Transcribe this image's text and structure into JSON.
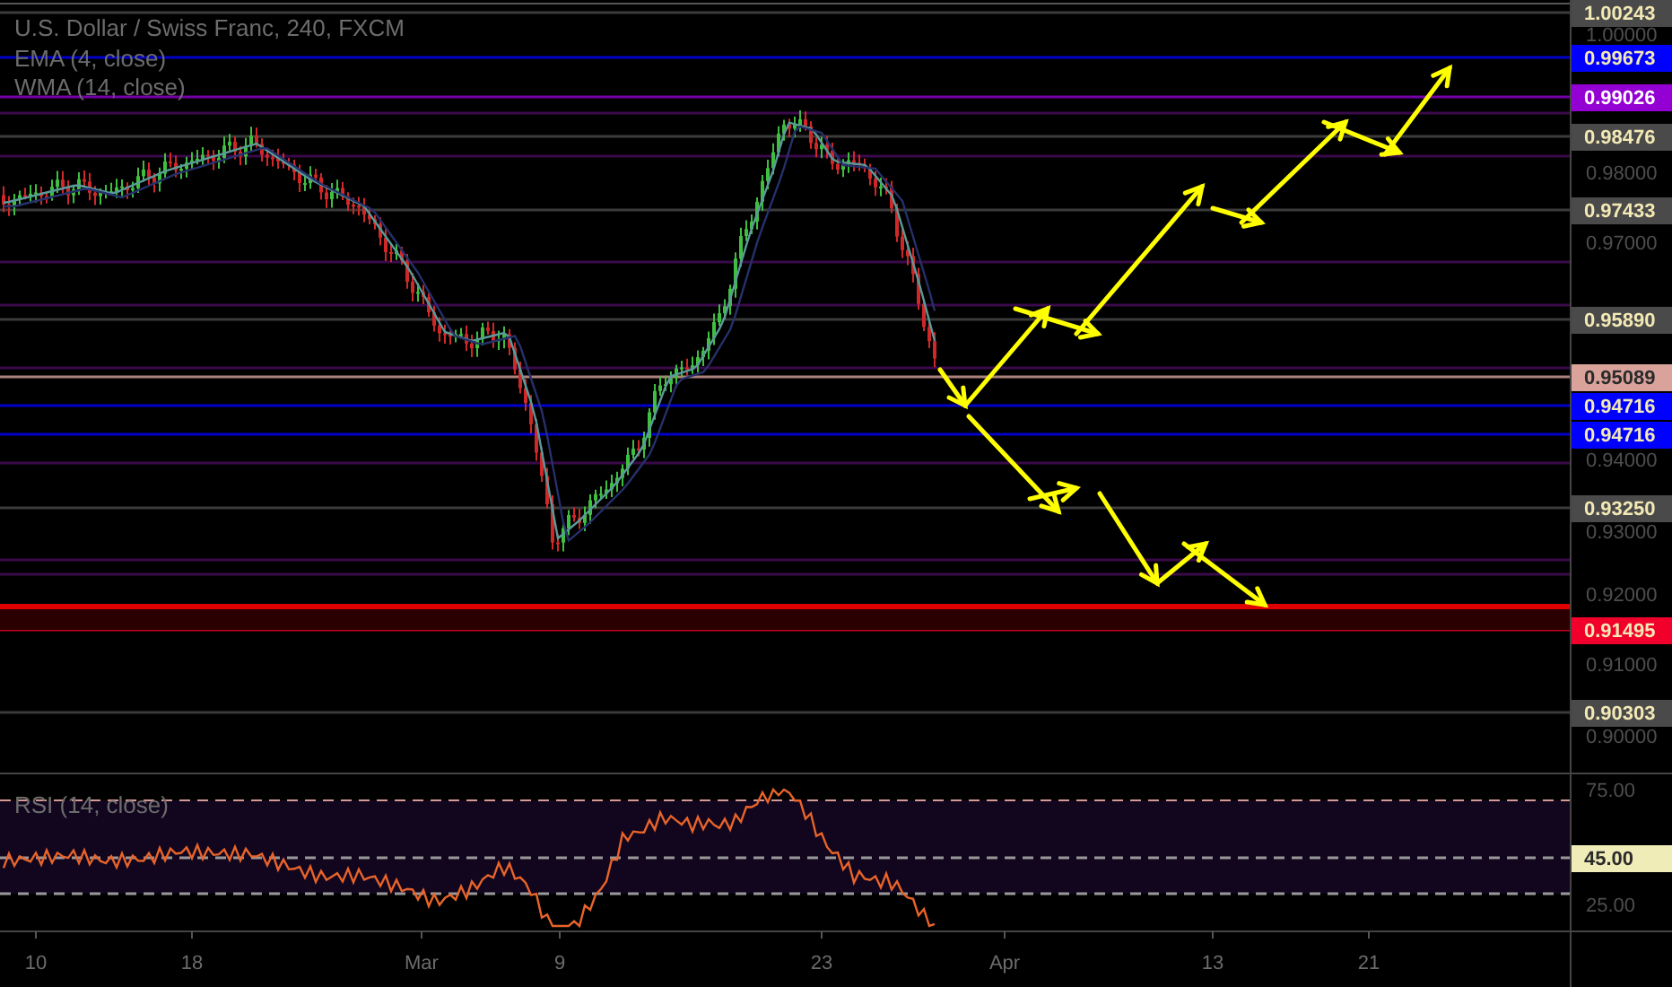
{
  "legend": {
    "symbol": "U.S. Dollar / Swiss Franc, 240, FXCM",
    "indicators": [
      "EMA (4, close)",
      "WMA (14, close)"
    ]
  },
  "price_axis": [
    {
      "label": "1.00243",
      "kind": "badge",
      "color": "#4a4a4a"
    },
    {
      "label": "1.00000",
      "kind": "tick"
    },
    {
      "label": "0.99673",
      "kind": "badge",
      "color": "#0000ff"
    },
    {
      "label": "0.99026",
      "kind": "badge",
      "color": "#9400d3"
    },
    {
      "label": "0.98476",
      "kind": "badge",
      "color": "#4a4a4a"
    },
    {
      "label": "0.98000",
      "kind": "tick"
    },
    {
      "label": "0.97433",
      "kind": "badge",
      "color": "#4a4a4a"
    },
    {
      "label": "0.97000",
      "kind": "tick"
    },
    {
      "label": "0.95890",
      "kind": "badge",
      "color": "#4a4a4a"
    },
    {
      "label": "0.95089",
      "kind": "badge",
      "color": "#d9a39c"
    },
    {
      "label": "0.94716",
      "kind": "badge",
      "color": "#0000ff"
    },
    {
      "label": "0.94716",
      "kind": "badge",
      "color": "#0000ff"
    },
    {
      "label": "0.94000",
      "kind": "tick"
    },
    {
      "label": "0.93250",
      "kind": "badge",
      "color": "#4a4a4a"
    },
    {
      "label": "0.93000",
      "kind": "tick"
    },
    {
      "label": "0.92000",
      "kind": "tick"
    },
    {
      "label": "0.91495",
      "kind": "badge",
      "color": "#f0002a"
    },
    {
      "label": "0.91000",
      "kind": "tick"
    },
    {
      "label": "0.90303",
      "kind": "badge",
      "color": "#4a4a4a"
    },
    {
      "label": "0.90000",
      "kind": "tick"
    }
  ],
  "rsi": {
    "label": "RSI (14, close)",
    "axis": [
      {
        "label": "75.00",
        "kind": "tick"
      },
      {
        "label": "45.00",
        "kind": "badge",
        "color": "#f0ecb8"
      },
      {
        "label": "25.00",
        "kind": "tick"
      }
    ]
  },
  "time_axis": [
    "10",
    "18",
    "Mar",
    "9",
    "23",
    "Apr",
    "13",
    "21"
  ]
}
